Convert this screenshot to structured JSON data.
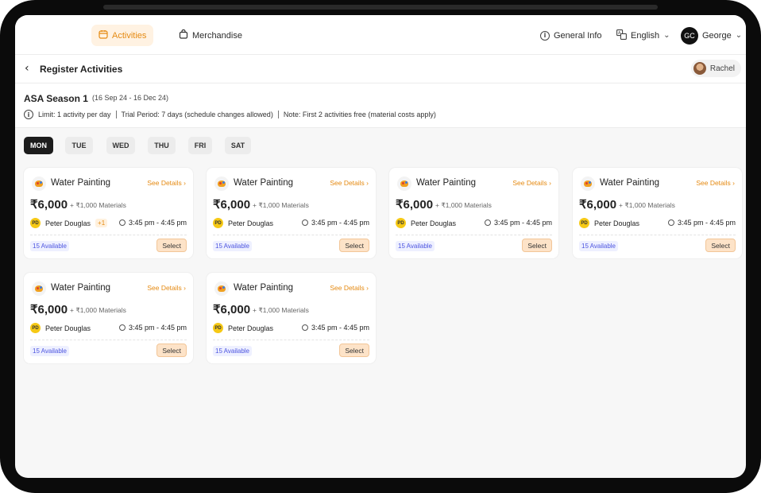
{
  "nav": {
    "tabs": [
      {
        "label": "Activities",
        "active": true,
        "icon": "calendar-icon"
      },
      {
        "label": "Merchandise",
        "active": false,
        "icon": "bag-icon"
      }
    ],
    "general_info": "General Info",
    "language": "English",
    "user_initials": "GC",
    "user_name": "George"
  },
  "subheader": {
    "title": "Register Activities",
    "child_name": "Rachel"
  },
  "season": {
    "title": "ASA Season 1",
    "dates": "(16 Sep 24 - 16 Dec 24)",
    "rules": [
      "Limit: 1 activity per day",
      "Trial Period: 7 days (schedule changes allowed)",
      "Note: First 2 activities free (material costs apply)"
    ]
  },
  "days": [
    "MON",
    "TUE",
    "WED",
    "THU",
    "FRI",
    "SAT"
  ],
  "active_day": "MON",
  "see_details_label": "See Details",
  "select_label": "Select",
  "cards": [
    {
      "title": "Water Painting",
      "price": "₹6,000",
      "materials": "+ ₹1,000 Materials",
      "teacher_initials": "PD",
      "teacher": "Peter Douglas",
      "extra_teachers": "+1",
      "time": "3:45 pm - 4:45 pm",
      "available": "15 Available"
    },
    {
      "title": "Water Painting",
      "price": "₹6,000",
      "materials": "+ ₹1,000 Materials",
      "teacher_initials": "PD",
      "teacher": "Peter Douglas",
      "extra_teachers": "",
      "time": "3:45 pm - 4:45 pm",
      "available": "15 Available"
    },
    {
      "title": "Water Painting",
      "price": "₹6,000",
      "materials": "+ ₹1,000 Materials",
      "teacher_initials": "PD",
      "teacher": "Peter Douglas",
      "extra_teachers": "",
      "time": "3:45 pm - 4:45 pm",
      "available": "15 Available"
    },
    {
      "title": "Water Painting",
      "price": "₹6,000",
      "materials": "+ ₹1,000 Materials",
      "teacher_initials": "PD",
      "teacher": "Peter Douglas",
      "extra_teachers": "",
      "time": "3:45 pm - 4:45 pm",
      "available": "15 Available"
    },
    {
      "title": "Water Painting",
      "price": "₹6,000",
      "materials": "+ ₹1,000 Materials",
      "teacher_initials": "PD",
      "teacher": "Peter Douglas",
      "extra_teachers": "",
      "time": "3:45 pm - 4:45 pm",
      "available": "15 Available"
    },
    {
      "title": "Water Painting",
      "price": "₹6,000",
      "materials": "+ ₹1,000 Materials",
      "teacher_initials": "PD",
      "teacher": "Peter Douglas",
      "extra_teachers": "",
      "time": "3:45 pm - 4:45 pm",
      "available": "15 Available"
    }
  ],
  "colors": {
    "accent": "#e58a12",
    "available": "#4d55e0",
    "active_day": "#1c1c1c"
  }
}
